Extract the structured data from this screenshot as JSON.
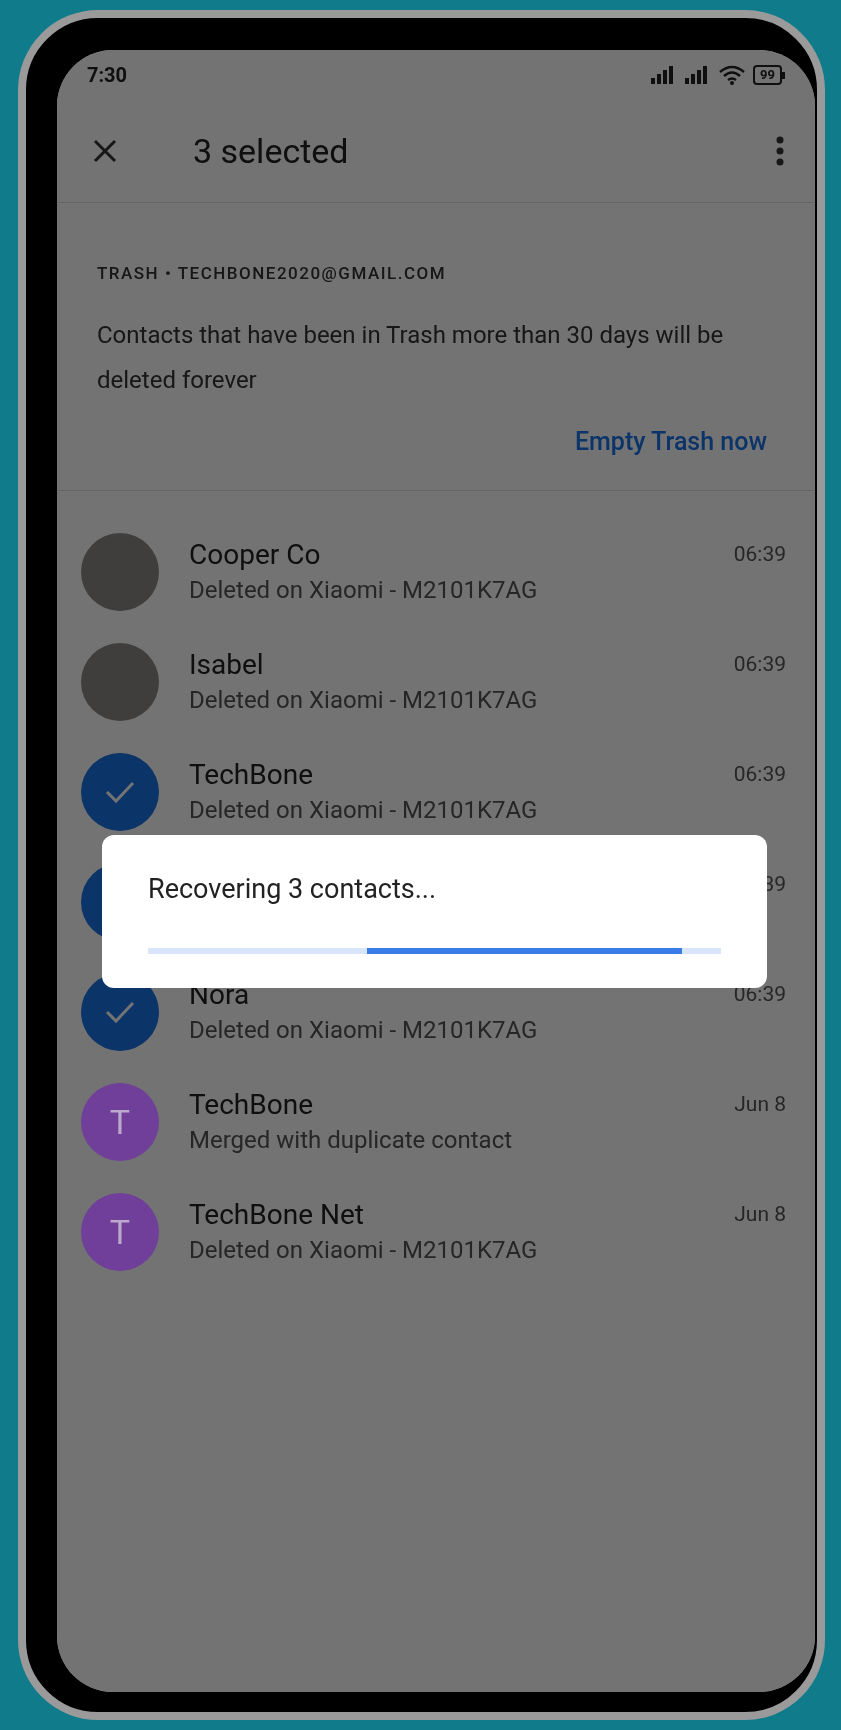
{
  "status_bar": {
    "time": "7:30",
    "battery": "99"
  },
  "toolbar": {
    "title": "3 selected"
  },
  "header": {
    "account": "TRASH • TECHBONE2020@GMAIL.COM",
    "description": "Contacts that have been in Trash more than 30 days will be deleted forever",
    "action": "Empty Trash now"
  },
  "contacts": [
    {
      "kind": "photo",
      "selected": false,
      "name": "Cooper Co",
      "subtitle": "Deleted on Xiaomi - M2101K7AG",
      "time": "06:39"
    },
    {
      "kind": "photo",
      "selected": false,
      "name": "Isabel",
      "subtitle": "Deleted on Xiaomi - M2101K7AG",
      "time": "06:39"
    },
    {
      "kind": "photo",
      "selected": true,
      "name": "TechBone",
      "subtitle": "Deleted on Xiaomi - M2101K7AG",
      "time": "06:39"
    },
    {
      "kind": "photo",
      "selected": true,
      "time": "39"
    },
    {
      "kind": "photo",
      "selected": true,
      "name": "Nora",
      "subtitle": "Deleted on Xiaomi - M2101K7AG",
      "time": "06:39"
    },
    {
      "kind": "letter",
      "letter": "T",
      "color": "#6f3f9a",
      "selected": false,
      "name": "TechBone",
      "subtitle": "Merged with duplicate contact",
      "time": "Jun 8"
    },
    {
      "kind": "letter",
      "letter": "T",
      "color": "#6f3f9a",
      "selected": false,
      "name": "TechBone Net",
      "subtitle": "Deleted on Xiaomi - M2101K7AG",
      "time": "Jun 8"
    }
  ],
  "dialog": {
    "message": "Recovering 3 contacts..."
  }
}
